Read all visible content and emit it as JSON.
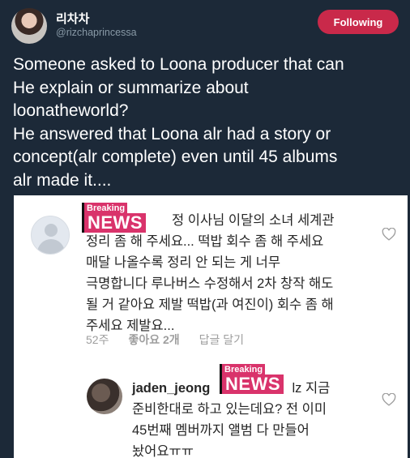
{
  "author": {
    "display_name": "리차차",
    "handle": "@rizchaprincessa",
    "follow_label": "Following"
  },
  "tweet_lines": [
    "Someone asked to Loona producer that can",
    "He explain or summarize about",
    "loonatheworld?",
    "He answered that Loona alr had a story or",
    "concept(alr complete) even until 45 albums",
    "alr made it...."
  ],
  "overlay": {
    "breaking": "Breaking",
    "news": "NEWS"
  },
  "comment1": {
    "lines": [
      "정 이사님 이달의 소녀 세계관",
      "정리 좀 해 주세요... 떡밥 회수 좀 해 주세요",
      "매달 나올수록 정리 안 되는 게 너무",
      "극명합니다 루나버스 수정해서 2차 창작 해도",
      "될 거 같아요 제발 떡밥(과 여진이) 회수 좀 해",
      "주세요 제발요..."
    ],
    "time": "52주",
    "likes": "좋아요 2개",
    "reply": "답글 달기"
  },
  "comment2": {
    "username": "jaden_jeong",
    "first_line_rest": "lz 지금",
    "lines": [
      "준비한대로 하고 있는데요? 전 이미",
      "45번째 멤버까지 앨범 다 만들어",
      "놨어요ㅠㅠ"
    ]
  }
}
